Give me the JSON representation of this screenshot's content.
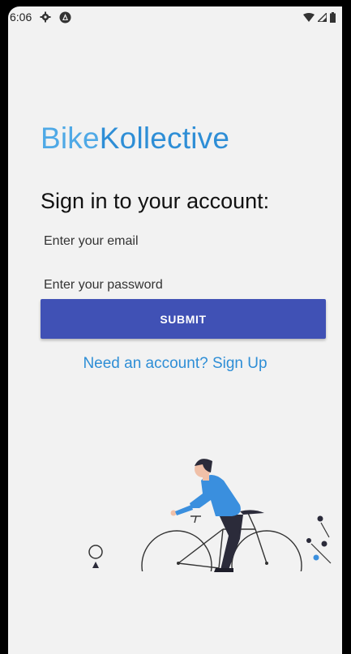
{
  "status_bar": {
    "time": "6:06",
    "icons": [
      "settings-icon",
      "app-notification-icon",
      "wifi-icon",
      "cell-signal-icon",
      "battery-icon"
    ]
  },
  "brand": {
    "part1": "Bike",
    "part2": "Kollective"
  },
  "heading": "Sign in to your account:",
  "form": {
    "email_placeholder": "Enter your email",
    "email_value": "",
    "password_placeholder": "Enter your password",
    "password_value": "",
    "submit_label": "SUBMIT"
  },
  "signup_link": "Need an account? Sign Up",
  "colors": {
    "accent": "#4051b5",
    "link": "#2e8ed6",
    "brand_light": "#4fa9e6",
    "illustration_blue": "#3a8fde"
  }
}
